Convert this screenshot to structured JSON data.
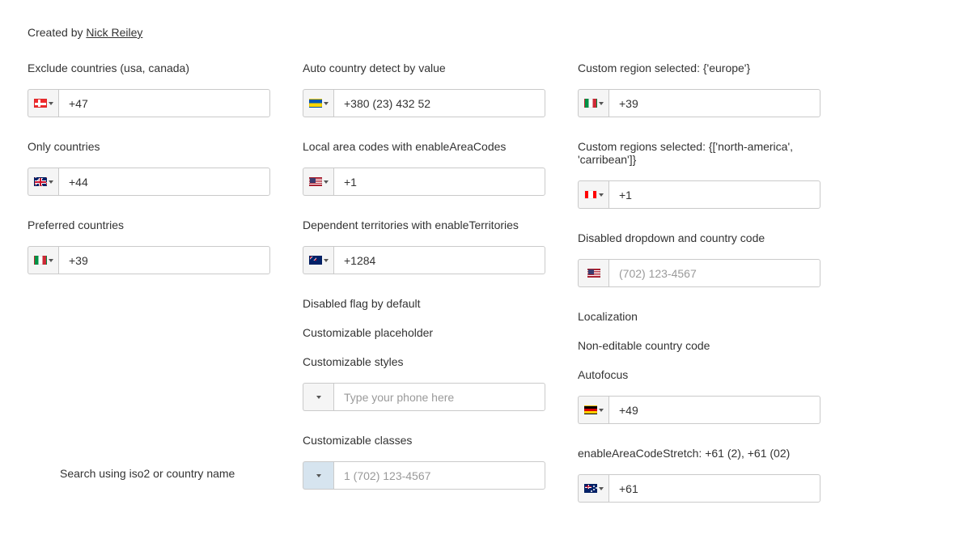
{
  "credit": {
    "prefix": "Created by ",
    "name": "Nick Reiley"
  },
  "col1": {
    "exclude_label": "Exclude countries (usa, canada)",
    "exclude_value": "+47",
    "only_label": "Only countries",
    "only_value": "+44",
    "preferred_label": "Preferred countries",
    "preferred_value": "+39",
    "search_label": "Search using iso2 or country name"
  },
  "col2": {
    "auto_label": "Auto country detect by value",
    "auto_value": "+380 (23) 432 52",
    "area_label": "Local area codes with enableAreaCodes",
    "area_value": "+1",
    "territories_label": "Dependent territories with enableTerritories",
    "territories_value": "+1284",
    "disabled_flag_label": "Disabled flag by default",
    "placeholder_label": "Customizable placeholder",
    "styles_label": "Customizable styles",
    "styles_placeholder": "Type your phone here",
    "classes_label": "Customizable classes",
    "classes_placeholder": "1 (702) 123-4567"
  },
  "col3": {
    "region1_label": "Custom region selected: {'europe'}",
    "region1_value": "+39",
    "region2_label": "Custom regions selected: {['north-america', 'carribean']}",
    "region2_value": "+1",
    "disabled_dd_label": "Disabled dropdown and country code",
    "disabled_dd_placeholder": "(702) 123-4567",
    "localization_label": "Localization",
    "noneditable_label": "Non-editable country code",
    "autofocus_label": "Autofocus",
    "autofocus_value": "+49",
    "stretch_label": "enableAreaCodeStretch: +61 (2), +61 (02)",
    "stretch_value": "+61"
  }
}
